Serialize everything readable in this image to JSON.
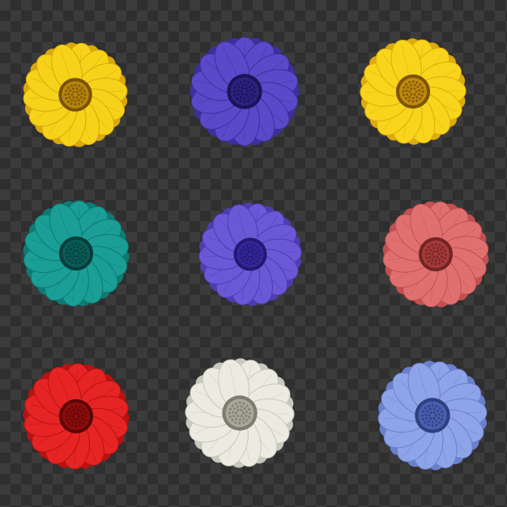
{
  "image": {
    "subject": "nine-daisy-flowers-on-transparency-grid",
    "background": {
      "checker_light": "#3b3b3b",
      "checker_dark": "#2f2f2f"
    },
    "flowers": [
      {
        "name": "yellow-daisy-top-left",
        "petal": "#f7d21a",
        "petal_dark": "#d9a80c",
        "center": "#b8860b",
        "center_dark": "#7a5206"
      },
      {
        "name": "violet-daisy-top-center",
        "petal": "#5a49c8",
        "petal_dark": "#3d2f9e",
        "center": "#2e2180",
        "center_dark": "#1c1458"
      },
      {
        "name": "yellow-daisy-top-right",
        "petal": "#f8d51c",
        "petal_dark": "#dcab0e",
        "center": "#c08a10",
        "center_dark": "#7d5408"
      },
      {
        "name": "teal-daisy-middle-left",
        "petal": "#1a9e96",
        "petal_dark": "#0f7a73",
        "center": "#0b5c57",
        "center_dark": "#063d3a"
      },
      {
        "name": "lavender-daisy-middle",
        "petal": "#6b58d6",
        "petal_dark": "#4d3db0",
        "center": "#34269a",
        "center_dark": "#221970"
      },
      {
        "name": "pink-daisy-middle-right",
        "petal": "#e07070",
        "petal_dark": "#c25050",
        "center": "#a63a3a",
        "center_dark": "#732424"
      },
      {
        "name": "red-daisy-bottom-left",
        "petal": "#e62424",
        "petal_dark": "#b81212",
        "center": "#8e0c0c",
        "center_dark": "#5c0606"
      },
      {
        "name": "white-daisy-bottom-center",
        "petal": "#ecebe2",
        "petal_dark": "#c9c8bc",
        "center": "#a8a89a",
        "center_dark": "#7c7c70"
      },
      {
        "name": "periwinkle-daisy-bottom-right",
        "petal": "#8ea4e8",
        "petal_dark": "#6a80cc",
        "center": "#4a5fb0",
        "center_dark": "#2f3f80"
      }
    ]
  }
}
